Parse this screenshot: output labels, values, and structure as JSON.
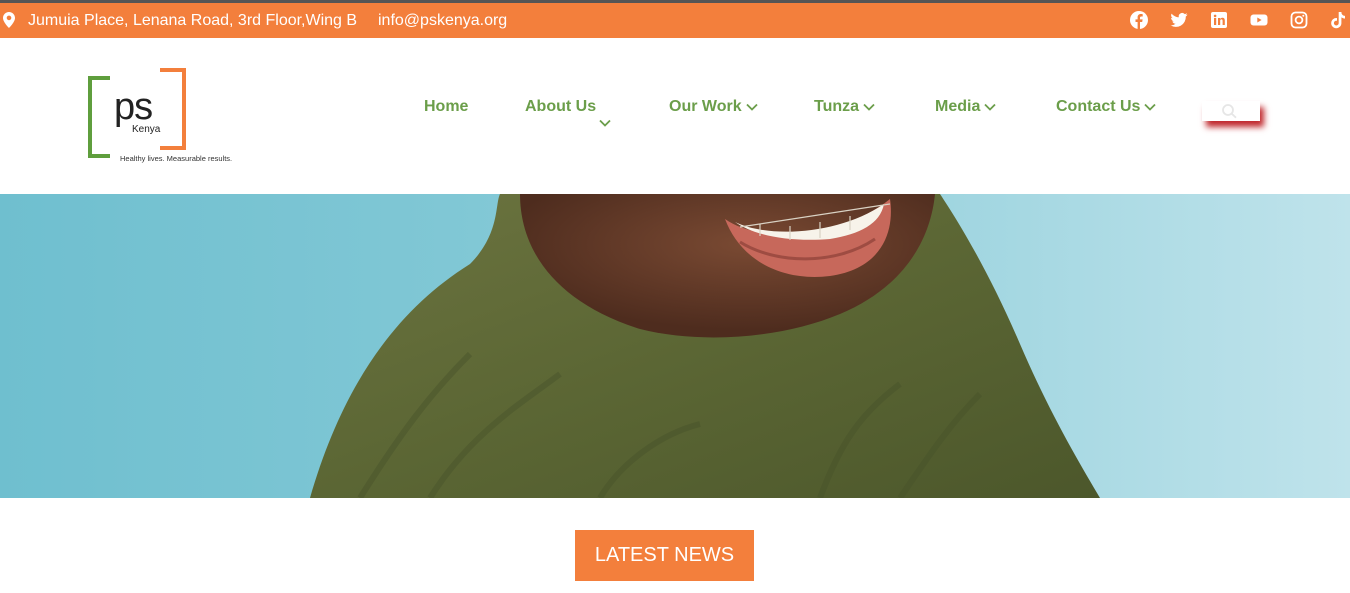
{
  "topbar": {
    "address": "Jumuia Place, Lenana Road, 3rd Floor,Wing B",
    "email": "info@pskenya.org",
    "social_icons": [
      "facebook-icon",
      "twitter-icon",
      "linkedin-icon",
      "youtube-icon",
      "instagram-icon",
      "tiktok-icon"
    ],
    "bg_color": "#f37f3c"
  },
  "logo": {
    "mark": "ps",
    "country": "Kenya",
    "tagline": "Healthy lives. Measurable results."
  },
  "nav": {
    "items": [
      {
        "label": "Home",
        "has_dropdown": false
      },
      {
        "label": "About Us",
        "has_dropdown": true
      },
      {
        "label": "Our Work",
        "has_dropdown": true
      },
      {
        "label": "Tunza",
        "has_dropdown": true
      },
      {
        "label": "Media",
        "has_dropdown": true
      },
      {
        "label": "Contact Us",
        "has_dropdown": true
      }
    ],
    "color": "#6b9e4a"
  },
  "search": {
    "icon": "search-icon"
  },
  "hero": {
    "description_icon": "hero-image"
  },
  "news": {
    "button_label": "LATEST NEWS"
  }
}
